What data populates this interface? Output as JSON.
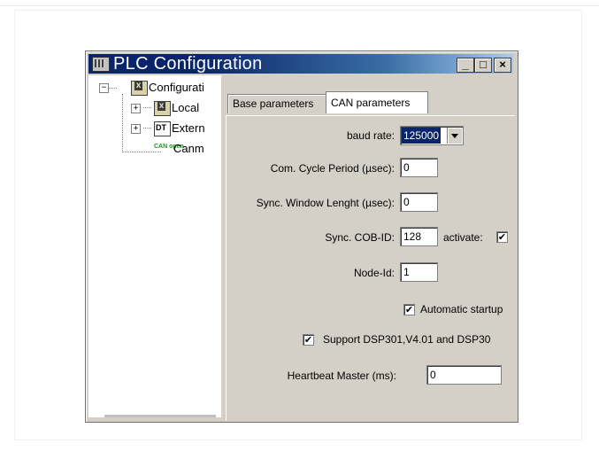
{
  "window": {
    "title": "PLC Configuration",
    "buttons": {
      "minimize": "_",
      "maximize": "□",
      "close": "×"
    }
  },
  "tree": {
    "items": [
      {
        "label": "Configurati",
        "expander": "−",
        "icon": "ec-icon"
      },
      {
        "label": "Local",
        "expander": "+",
        "icon": "ec-icon"
      },
      {
        "label": "Extern",
        "expander": "+",
        "icon": "dt-icon"
      },
      {
        "label": "Canm",
        "icon": "canopen-icon",
        "icon_text": "CAN open"
      }
    ]
  },
  "tabs": [
    {
      "label": "Base parameters",
      "active": false
    },
    {
      "label": "CAN parameters",
      "active": true
    }
  ],
  "form": {
    "baud_rate": {
      "label": "baud rate:",
      "value": "125000"
    },
    "com_cycle": {
      "label": "Com. Cycle Period (µsec):",
      "value": "0"
    },
    "sync_window": {
      "label": "Sync. Window Lenght (µsec):",
      "value": "0"
    },
    "sync_cob": {
      "label": "Sync. COB-ID:",
      "value": "128",
      "activate_label": "activate:",
      "activate_checked": "✔"
    },
    "node_id": {
      "label": "Node-Id:",
      "value": "1"
    },
    "auto_startup": {
      "label": "Automatic startup",
      "checked": "✔"
    },
    "support_dsp": {
      "label": "Support DSP301,V4.01 and DSP30",
      "checked": "✔"
    },
    "heartbeat": {
      "label": "Heartbeat Master (ms):",
      "value": "0"
    }
  },
  "colors": {
    "titlebar_start": "#0a246a",
    "titlebar_end": "#a6caf0",
    "face": "#d4d0c8",
    "selection": "#0a246a"
  }
}
